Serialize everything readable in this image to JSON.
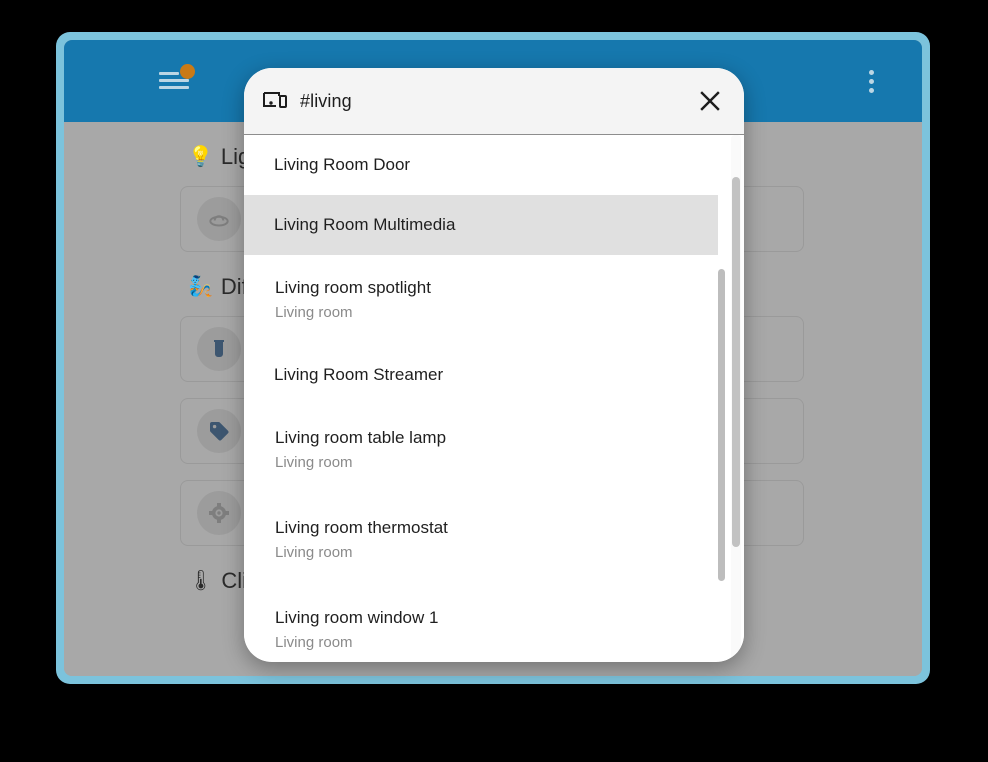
{
  "window": {
    "frame_color": "#7cc3dc",
    "toolbar_color": "#1678ae",
    "background_color": "#000000"
  },
  "toolbar": {
    "menu_icon": "hamburger-menu-icon",
    "menu_badge_color": "#c97a16",
    "tabs": [
      {
        "icon": "sofa-icon",
        "label": "",
        "active": true
      },
      {
        "icon": "gift-icon",
        "label": "",
        "active": false
      }
    ],
    "overflow_icon": "more-vertical-icon"
  },
  "background_page": {
    "sections": [
      {
        "emoji": "💡",
        "title": "Lights",
        "cards": [
          {
            "icon": "ceiling-light-icon"
          }
        ]
      },
      {
        "emoji": "🧞",
        "title": "Different",
        "cards": [
          {
            "icon": "beaker-icon"
          },
          {
            "icon": "tag-icon"
          },
          {
            "icon": "target-icon"
          }
        ]
      },
      {
        "emoji": "🌡",
        "title": "Climate",
        "cards": []
      }
    ]
  },
  "dialog": {
    "icon": "devices-icon",
    "title": "#living",
    "close_label": "×",
    "close_icon": "close-icon",
    "items": [
      {
        "primary": "Living Room Door",
        "secondary": "",
        "selected": false
      },
      {
        "primary": "Living Room Multimedia",
        "secondary": "",
        "selected": true
      },
      {
        "primary": "Living room spotlight",
        "secondary": "Living room",
        "selected": false
      },
      {
        "primary": "Living Room Streamer",
        "secondary": "",
        "selected": false
      },
      {
        "primary": "Living room table lamp",
        "secondary": "Living room",
        "selected": false
      },
      {
        "primary": "Living room thermostat",
        "secondary": "Living room",
        "selected": false
      },
      {
        "primary": "Living room window 1",
        "secondary": "Living room",
        "selected": false
      }
    ],
    "selected_row_color": "#e0e0e0",
    "header_color": "#f4f4f4"
  }
}
